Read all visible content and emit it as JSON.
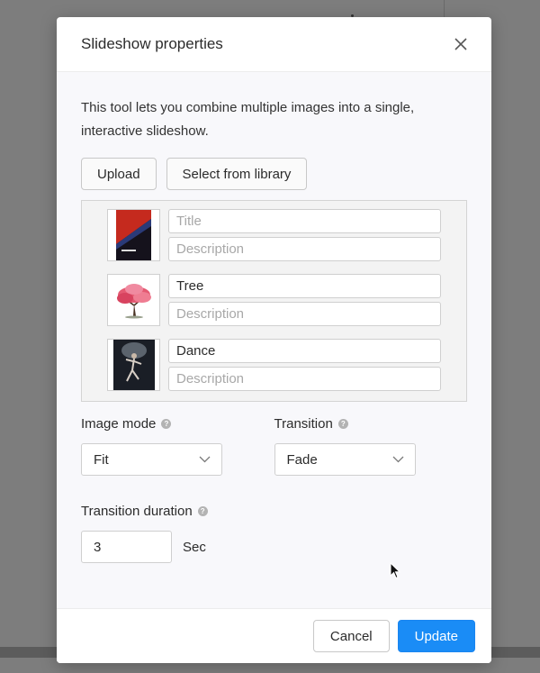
{
  "dialog": {
    "title": "Slideshow properties",
    "close_icon": "close-icon",
    "intro": "This tool lets you combine multiple images into a single, interactive slideshow."
  },
  "actions": {
    "upload_label": "Upload",
    "library_label": "Select from library"
  },
  "images": [
    {
      "title": "",
      "title_placeholder": "Title",
      "description": "",
      "description_placeholder": "Description",
      "thumb": "dark-red-poster"
    },
    {
      "title": "Tree",
      "title_placeholder": "Title",
      "description": "",
      "description_placeholder": "Description",
      "thumb": "pink-tree"
    },
    {
      "title": "Dance",
      "title_placeholder": "Title",
      "description": "",
      "description_placeholder": "Description",
      "thumb": "dancer"
    }
  ],
  "image_mode": {
    "label": "Image mode",
    "value": "Fit",
    "help_icon": "help-icon"
  },
  "transition": {
    "label": "Transition",
    "value": "Fade",
    "help_icon": "help-icon"
  },
  "duration": {
    "label": "Transition duration",
    "value": "3",
    "unit": "Sec",
    "help_icon": "help-icon"
  },
  "footer": {
    "cancel_label": "Cancel",
    "update_label": "Update"
  },
  "colors": {
    "accent": "#1a8cf6",
    "body_bg": "#f8f8fb",
    "overlay": "#7d7d7d"
  }
}
